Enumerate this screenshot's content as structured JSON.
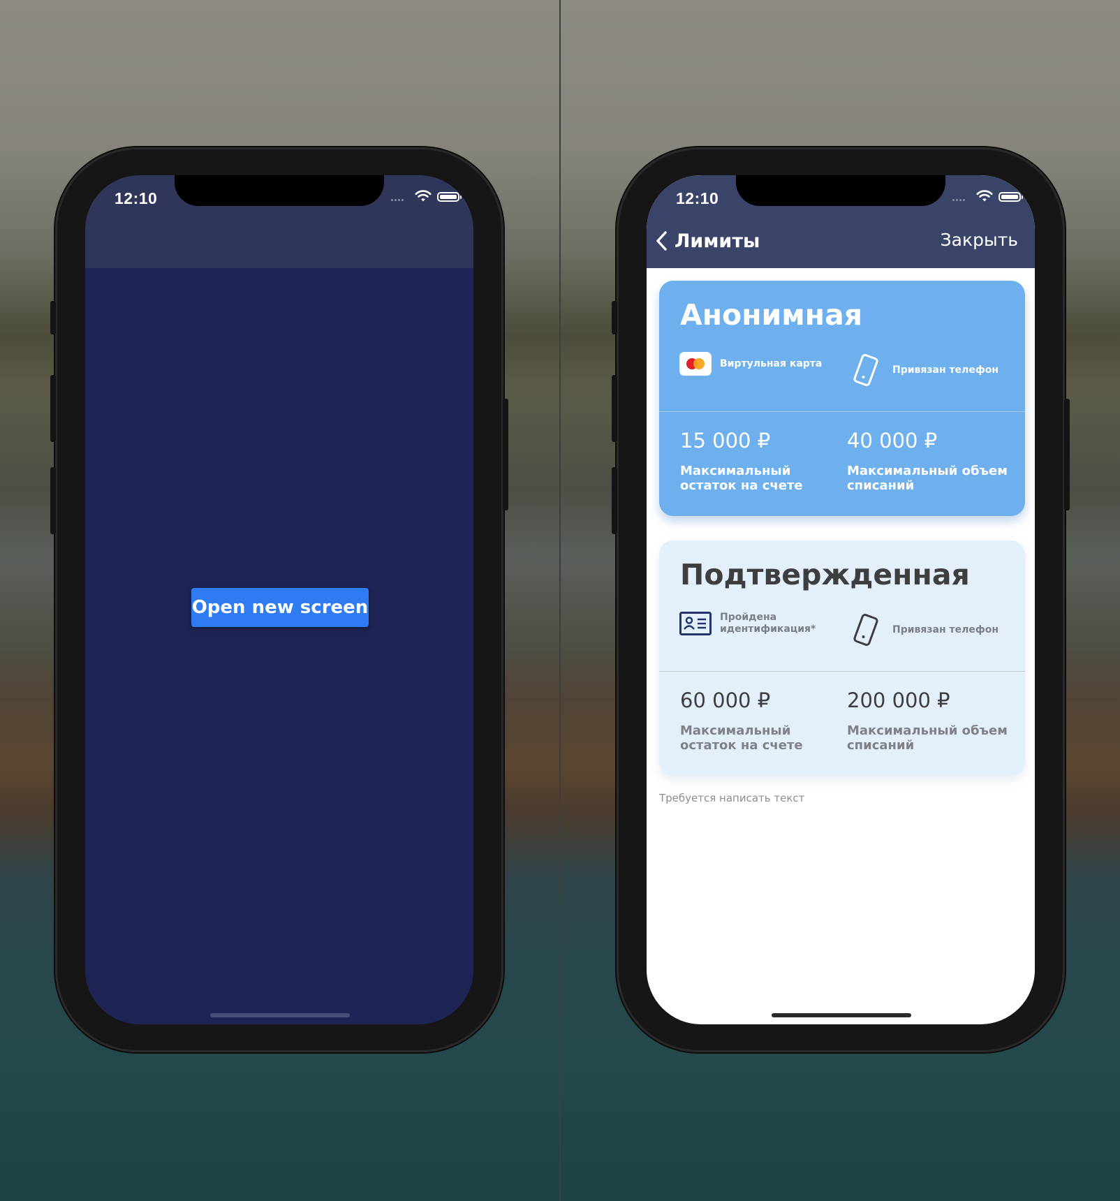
{
  "left_screen": {
    "status_time": "12:10",
    "button_label": "Open new screen"
  },
  "right_screen": {
    "status_time": "12:10",
    "nav": {
      "title": "Лимиты",
      "close_label": "Закрыть"
    },
    "cards": [
      {
        "title": "Анонимная",
        "features": [
          {
            "icon": "card-icon",
            "label": "Виртульная карта"
          },
          {
            "icon": "phone-icon",
            "label": "Привязан телефон"
          }
        ],
        "limits": [
          {
            "amount": "15 000 ₽",
            "description": "Максимальный остаток на счете"
          },
          {
            "amount": "40 000 ₽",
            "description": "Максимальный объем списаний"
          }
        ],
        "colors": {
          "background": "#6eb0ee",
          "text": "#ffffff"
        }
      },
      {
        "title": "Подтвержденная",
        "features": [
          {
            "icon": "id-card-icon",
            "label": "Пройдена идентификация*"
          },
          {
            "icon": "phone-icon",
            "label": "Привязан телефон"
          }
        ],
        "limits": [
          {
            "amount": "60 000 ₽",
            "description": "Максимальный остаток на счете"
          },
          {
            "amount": "200 000 ₽",
            "description": "Максимальный объем списаний"
          }
        ],
        "colors": {
          "background": "#e3f0fc",
          "text": "#3e3e3e"
        }
      }
    ],
    "footnote": "Требуется написать текст"
  },
  "colors": {
    "left_background": "#1e2554",
    "left_navbar": "#2f3659",
    "right_navbar": "#3a4468",
    "button": "#2f7bf2"
  }
}
